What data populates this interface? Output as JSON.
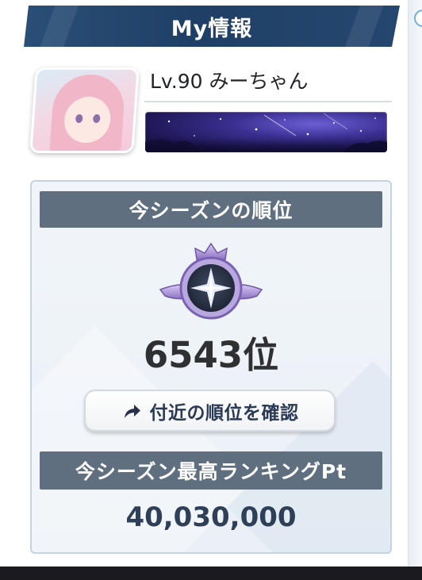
{
  "header": {
    "title": "My情報"
  },
  "player": {
    "level_name": "Lv.90 みーちゃん"
  },
  "season_rank": {
    "section_title": "今シーズンの順位",
    "rank_text": "6543位",
    "nearby_button_label": "付近の順位を確認"
  },
  "season_best": {
    "section_title": "今シーズン最高ランキングPt",
    "points": "40,030,000"
  },
  "icons": {
    "rank_emblem": "rank-emblem-icon",
    "share_arrow": "share-arrow-icon"
  },
  "colors": {
    "header_bg": "#1f3f66",
    "section_bar_bg": "#5f6f80",
    "points_text": "#2f3f57"
  }
}
